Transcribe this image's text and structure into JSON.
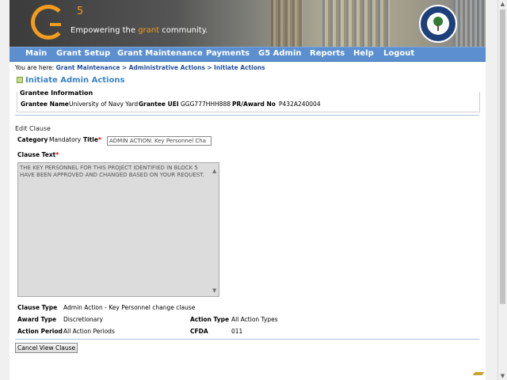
{
  "banner": {
    "logo_mark": "5",
    "tagline_before": "Empowering the ",
    "tagline_accent": "grant",
    "tagline_after": " community.",
    "seal_name": "department-of-education-seal"
  },
  "nav": [
    "Main",
    "Grant Setup",
    "Grant Maintenance",
    "Payments",
    "G5 Admin",
    "Reports",
    "Help",
    "Logout"
  ],
  "breadcrumb": {
    "prefix": "You are here:",
    "items": [
      "Grant Maintenance",
      "Administrative Actions",
      "Initiate Actions"
    ],
    "separator": ">"
  },
  "page_title": "Initiate Admin Actions",
  "grantee": {
    "legend": "Grantee Information",
    "name_label": "Grantee Name",
    "name_value": "University of Navy Yard",
    "uei_label": "Grantee UEI",
    "uei_value": "GGG777HHH888",
    "award_label": "PR/Award No",
    "award_value": "P432A240004"
  },
  "edit_clause": {
    "heading": "Edit Clause",
    "category_label": "Category",
    "category_value": "Mandatory",
    "title_label": "Title",
    "required_mark": "*",
    "title_value": "ADMIN ACTION:  Key Personnel Cha",
    "clause_text_label": "Clause Text",
    "clause_text_value": "THE KEY PERSONNEL FOR THIS PROJECT IDENTIFIED IN BLOCK 5 HAVE BEEN APPROVED AND CHANGED BASED ON YOUR REQUEST.",
    "clause_type_label": "Clause Type",
    "clause_type_value": "Admin Action - Key Personnel change clause",
    "award_type_label": "Award Type",
    "award_type_value": "Discretionary",
    "action_type_label": "Action Type",
    "action_type_value": "All Action Types",
    "action_period_label": "Action Period",
    "action_period_value": "All Action Periods",
    "cfda_label": "CFDA",
    "cfda_value": "011"
  },
  "buttons": {
    "cancel": "Cancel View Clause"
  },
  "colors": {
    "nav_bg": "#5b8fcf",
    "title_blue": "#3b82c4",
    "link_blue": "#1f4fa0",
    "brand_orange": "#f39c1e",
    "required_red": "#cc0000"
  }
}
